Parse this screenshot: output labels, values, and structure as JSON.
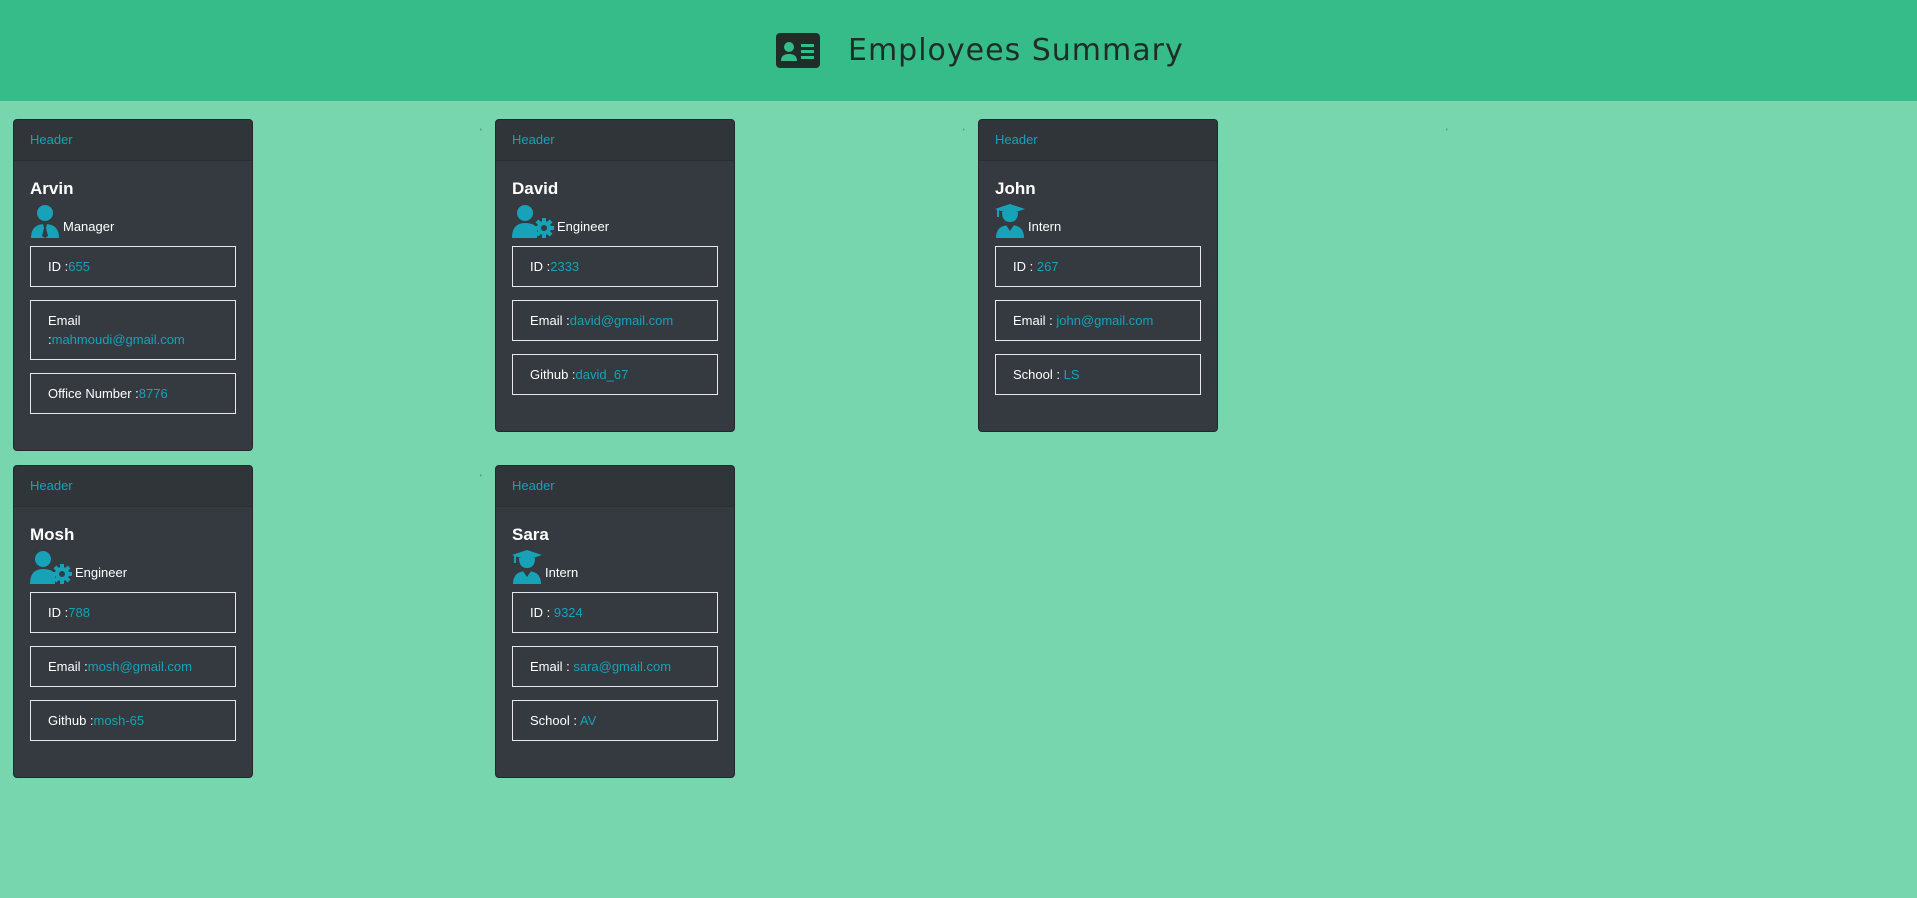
{
  "header": {
    "title": "Employees Summary",
    "icon": "id-card-icon",
    "background": "#36bc89"
  },
  "page_background": "#77d6ae",
  "accent": "#17a2b8",
  "stray_marks": [
    "'",
    "'",
    "'",
    "'"
  ],
  "cards": [
    {
      "header": "Header",
      "name": "Arvin",
      "role": "Manager",
      "icon": "manager-tie-icon",
      "fields": [
        {
          "label": "ID :",
          "value": "655"
        },
        {
          "label": "Email :",
          "value": "mahmoudi@gmail.com"
        },
        {
          "label": "Office Number :",
          "value": "8776"
        }
      ]
    },
    {
      "header": "Header",
      "name": "David",
      "role": "Engineer",
      "icon": "user-gear-icon",
      "fields": [
        {
          "label": "ID :",
          "value": "2333"
        },
        {
          "label": "Email :",
          "value": "david@gmail.com"
        },
        {
          "label": "Github :",
          "value": "david_67"
        }
      ]
    },
    {
      "header": "Header",
      "name": "John",
      "role": "Intern",
      "icon": "user-graduate-icon",
      "fields": [
        {
          "label": "ID : ",
          "value": "267"
        },
        {
          "label": "Email : ",
          "value": "john@gmail.com"
        },
        {
          "label": "School : ",
          "value": "LS"
        }
      ]
    },
    {
      "header": "Header",
      "name": "Mosh",
      "role": "Engineer",
      "icon": "user-gear-icon",
      "fields": [
        {
          "label": "ID :",
          "value": "788"
        },
        {
          "label": "Email :",
          "value": "mosh@gmail.com"
        },
        {
          "label": "Github :",
          "value": "mosh-65"
        }
      ]
    },
    {
      "header": "Header",
      "name": "Sara",
      "role": "Intern",
      "icon": "user-graduate-icon",
      "fields": [
        {
          "label": "ID : ",
          "value": "9324"
        },
        {
          "label": "Email : ",
          "value": "sara@gmail.com"
        },
        {
          "label": "School : ",
          "value": "AV"
        }
      ]
    }
  ]
}
